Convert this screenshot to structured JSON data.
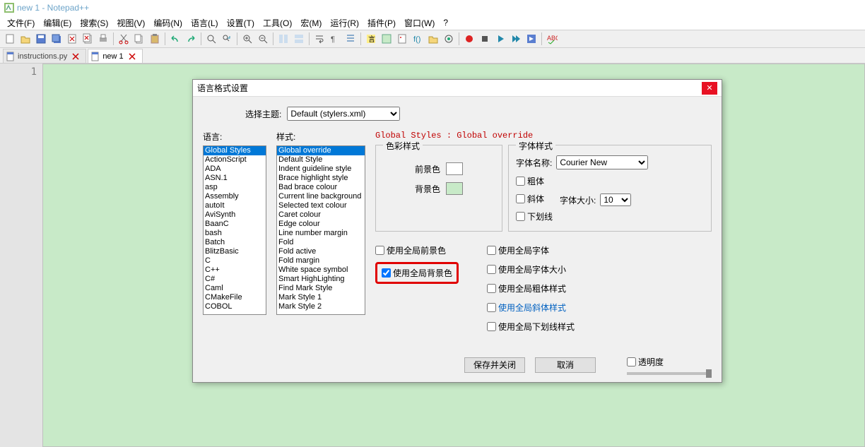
{
  "window": {
    "title": "new 1 - Notepad++"
  },
  "menus": [
    "文件(F)",
    "编辑(E)",
    "搜索(S)",
    "视图(V)",
    "编码(N)",
    "语言(L)",
    "设置(T)",
    "工具(O)",
    "宏(M)",
    "运行(R)",
    "插件(P)",
    "窗口(W)",
    "?"
  ],
  "tabs": [
    {
      "label": "instructions.py",
      "active": false
    },
    {
      "label": "new 1",
      "active": true
    }
  ],
  "gutter": {
    "line1": "1"
  },
  "dialog": {
    "title": "语言格式设置",
    "theme_label": "选择主题:",
    "theme_value": "Default (stylers.xml)",
    "lang_label": "语言:",
    "style_label": "样式:",
    "langs": [
      "Global Styles",
      "ActionScript",
      "ADA",
      "ASN.1",
      "asp",
      "Assembly",
      "autoIt",
      "AviSynth",
      "BaanC",
      "bash",
      "Batch",
      "BlitzBasic",
      "C",
      "C++",
      "C#",
      "Caml",
      "CMakeFile",
      "COBOL"
    ],
    "lang_selected": "Global Styles",
    "styles": [
      "Global override",
      "Default Style",
      "Indent guideline style",
      "Brace highlight style",
      "Bad brace colour",
      "Current line background",
      "Selected text colour",
      "Caret colour",
      "Edge colour",
      "Line number margin",
      "Fold",
      "Fold active",
      "Fold margin",
      "White space symbol",
      "Smart HighLighting",
      "Find Mark Style",
      "Mark Style 1",
      "Mark Style 2"
    ],
    "style_selected": "Global override",
    "heading": "Global Styles : Global override",
    "color_group": "色彩样式",
    "fg_label": "前景色",
    "bg_label": "背景色",
    "fg_color": "#ffffff",
    "bg_color": "#c8eac8",
    "font_group": "字体样式",
    "font_name_label": "字体名称:",
    "font_name_value": "Courier New",
    "bold": "粗体",
    "italic": "斜体",
    "underline": "下划线",
    "font_size_label": "字体大小:",
    "font_size_value": "10",
    "global_fg": "使用全局前景色",
    "global_bg": "使用全局背景色",
    "global_font": "使用全局字体",
    "global_size": "使用全局字体大小",
    "global_bold": "使用全局粗体样式",
    "global_italic": "使用全局斜体样式",
    "global_underline": "使用全局下划线样式",
    "save_close": "保存并关闭",
    "cancel": "取消",
    "transparency": "透明度"
  }
}
